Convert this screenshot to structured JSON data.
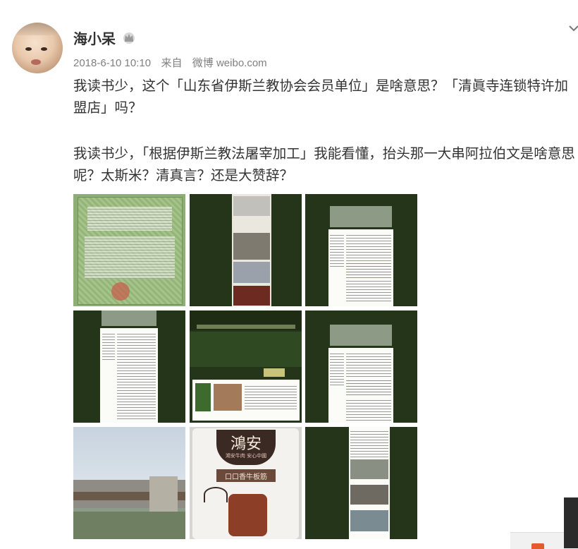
{
  "post": {
    "author": "海小呆",
    "timestamp": "2018-6-10 10:10",
    "source_prefix": "来自",
    "source": "微博 weibo.com",
    "paragraph1": "我读书少，这个「山东省伊斯兰教协会会员单位」是啥意思？「清眞寺连锁特许加盟店」吗？",
    "paragraph2": "我读书少，「根据伊斯兰教法屠宰加工」我能看懂，抬头那一大串阿拉伯文是啥意思呢？太斯米？清真言？还是大赞辞？"
  },
  "icons": {
    "badge": "crown-icon",
    "menu": "chevron-down-icon"
  },
  "images": [
    {
      "name": "halal-certificate"
    },
    {
      "name": "slaughter-photos"
    },
    {
      "name": "webpage-screenshot"
    },
    {
      "name": "webpage-article"
    },
    {
      "name": "company-website"
    },
    {
      "name": "webpage-screenshot-2"
    },
    {
      "name": "factory-gate-photo"
    },
    {
      "name": "beef-tendon-package"
    },
    {
      "name": "news-photos-page"
    }
  ],
  "package_text": {
    "brand": "鴻安",
    "slogan": "鴻安牛肉 安心中國",
    "product": "口口香牛板筋"
  },
  "colors": {
    "dark_bg": "#24351a",
    "text": "#333333",
    "meta": "#808080"
  }
}
